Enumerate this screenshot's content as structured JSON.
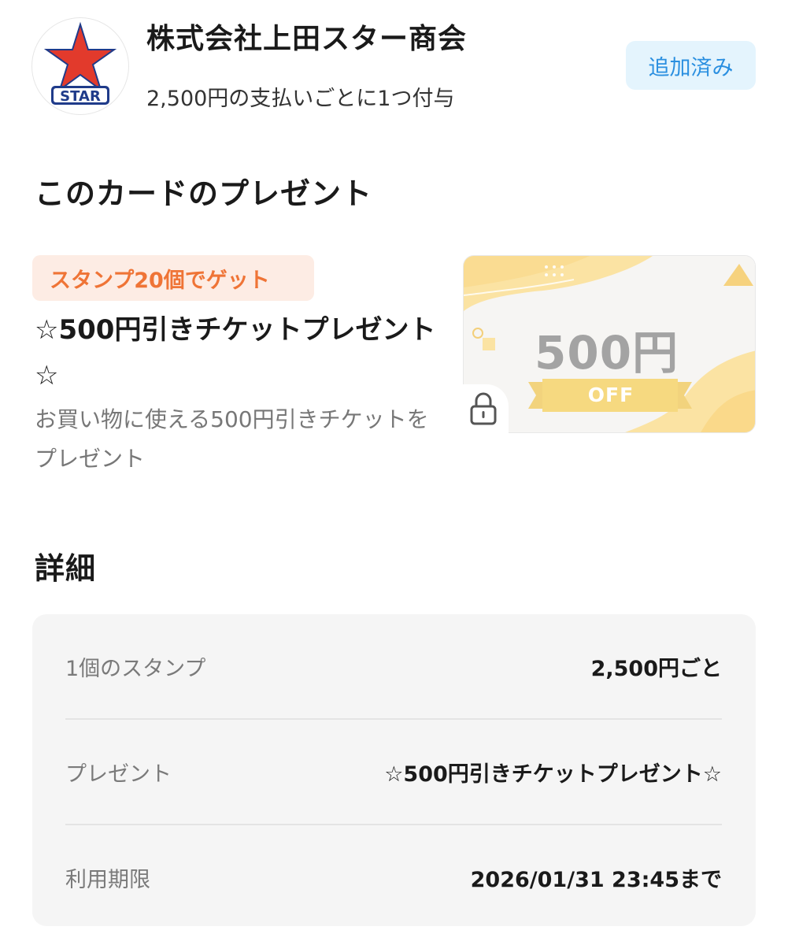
{
  "shop": {
    "logo_text": "STAR",
    "name": "株式会社上田スター商会",
    "rule": "2,500円の支払いごとに1つ付与",
    "added_label": "追加済み"
  },
  "present": {
    "section_title": "このカードのプレゼント",
    "stamp_tag": "スタンプ20個でゲット",
    "reward_name": "☆500円引きチケットプレゼント☆",
    "reward_description": "お買い物に使える500円引きチケットをプレゼント",
    "coupon_amount": "500円",
    "coupon_off": "OFF"
  },
  "details": {
    "section_title": "詳細",
    "rows": [
      {
        "label": "1個のスタンプ",
        "value": "2,500円ごと"
      },
      {
        "label": "プレゼント",
        "value": "☆500円引きチケットプレゼント☆"
      },
      {
        "label": "利用期限",
        "value": "2026/01/31 23:45まで"
      }
    ]
  },
  "colors": {
    "badge_bg": "#e4f4fd",
    "badge_text": "#2a8fe0",
    "stamp_tag_bg": "#fdece4",
    "stamp_tag_text": "#ef7436",
    "logo_star": "#e23a2c",
    "logo_navy": "#1f3b8a"
  }
}
